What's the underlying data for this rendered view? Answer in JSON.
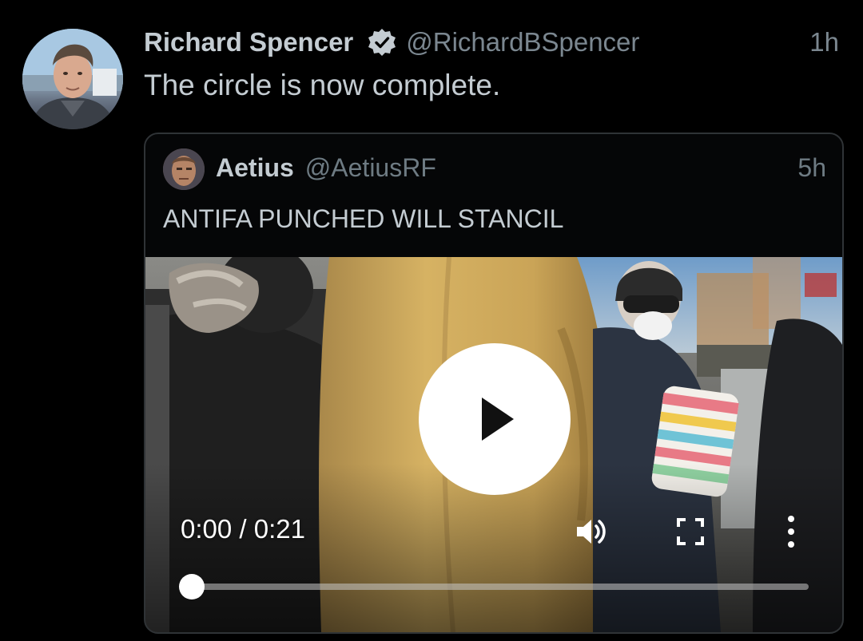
{
  "tweet": {
    "author": {
      "display_name": "Richard Spencer",
      "handle": "@RichardBSpencer",
      "verified": true
    },
    "time": "1h",
    "text": "The circle is now complete."
  },
  "quoted_tweet": {
    "author": {
      "display_name": "Aetius",
      "handle": "@AetiusRF"
    },
    "time": "5h",
    "text": "ANTIFA PUNCHED WILL STANCIL",
    "video": {
      "current_time": "0:00",
      "duration": "0:21",
      "timestamp_text": "0:00 / 0:21",
      "progress": 0
    }
  },
  "icons": {
    "verified": "verified-badge-icon",
    "play": "play-icon",
    "volume": "volume-icon",
    "fullscreen": "fullscreen-icon",
    "more": "more-vertical-icon"
  },
  "colors": {
    "background": "#000000",
    "primary_text": "#c4ccd2",
    "secondary_text": "#7b8790",
    "border": "#2f3336",
    "verified_badge": "#c4ccd2"
  }
}
